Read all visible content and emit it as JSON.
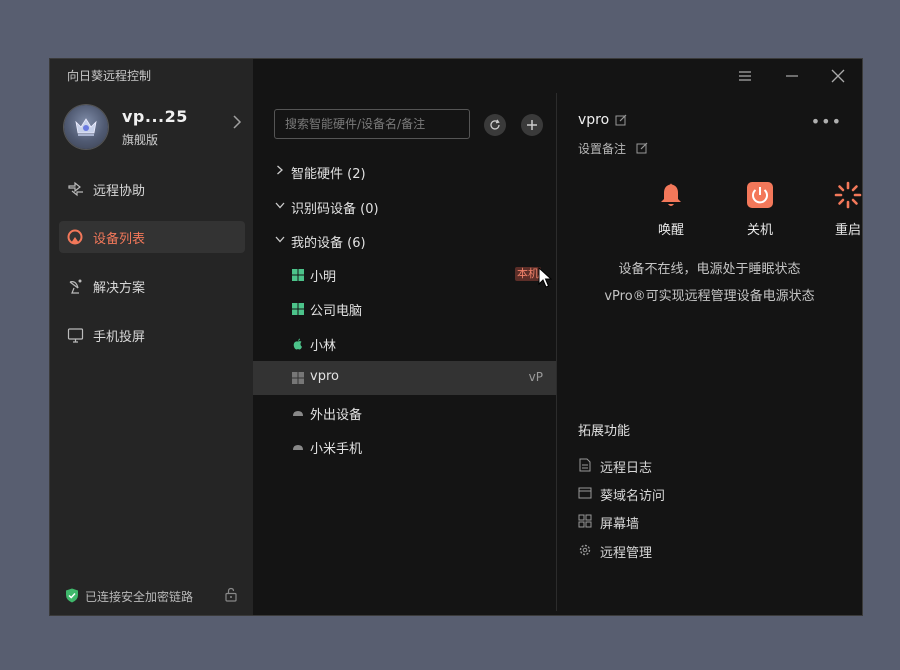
{
  "app": {
    "title": "向日葵远程控制"
  },
  "profile": {
    "name": "vp...25",
    "level": "旗舰版"
  },
  "sidebar": {
    "items": [
      {
        "label": "远程协助"
      },
      {
        "label": "设备列表"
      },
      {
        "label": "解决方案"
      },
      {
        "label": "手机投屏"
      }
    ],
    "security_status": "已连接安全加密链路"
  },
  "search": {
    "placeholder": "搜索智能硬件/设备名/备注"
  },
  "device_groups": [
    {
      "label": "智能硬件 (2)",
      "expanded": false
    },
    {
      "label": "识别码设备 (0)",
      "expanded": true
    },
    {
      "label": "我的设备 (6)",
      "expanded": true
    }
  ],
  "devices": [
    {
      "name": "小明",
      "icon": "windows-icon",
      "badge": "本机"
    },
    {
      "name": "公司电脑",
      "icon": "windows-icon"
    },
    {
      "name": "小林",
      "icon": "apple-icon"
    },
    {
      "name": "vpro",
      "icon": "windows-icon",
      "tag": "vP",
      "selected": true
    },
    {
      "name": "外出设备",
      "icon": "cloud-icon"
    },
    {
      "name": "小米手机",
      "icon": "cloud-icon"
    }
  ],
  "detail": {
    "device_name": "vpro",
    "remark_label": "设置备注",
    "actions": [
      {
        "label": "唤醒",
        "icon": "bell-icon"
      },
      {
        "label": "关机",
        "icon": "power-icon"
      },
      {
        "label": "重启",
        "icon": "restart-icon"
      }
    ],
    "offline_lines": [
      "设备不在线，电源处于睡眠状态",
      "vPro®可实现远程管理设备电源状态"
    ],
    "extensions_title": "拓展功能",
    "extensions": [
      {
        "label": "远程日志",
        "icon": "document-icon"
      },
      {
        "label": "葵域名访问",
        "icon": "browser-icon"
      },
      {
        "label": "屏幕墙",
        "icon": "grid-icon"
      },
      {
        "label": "远程管理",
        "icon": "gear-icon"
      }
    ]
  },
  "colors": {
    "accent": "#f3785a",
    "sidebar_bg": "#252525",
    "main_bg": "#141414",
    "selected_bg": "#333333"
  }
}
